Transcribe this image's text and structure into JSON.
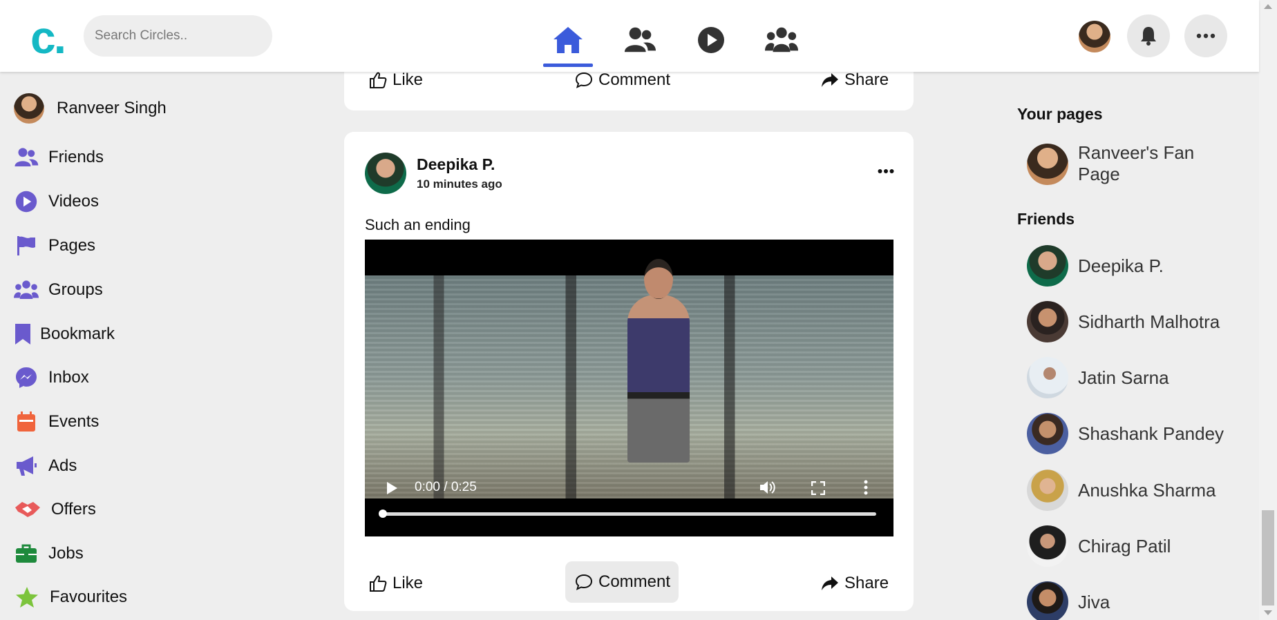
{
  "header": {
    "logo_text": "c.",
    "search_placeholder": "Search Circles..",
    "nav": [
      {
        "name": "home",
        "active": true
      },
      {
        "name": "friends",
        "active": false
      },
      {
        "name": "watch",
        "active": false
      },
      {
        "name": "groups",
        "active": false
      }
    ],
    "accent_color": "#3b5bdb",
    "logo_color": "#14b8c4"
  },
  "left_sidebar": {
    "profile_name": "Ranveer Singh",
    "items": [
      {
        "label": "Friends",
        "icon": "friends-icon",
        "color": "#6a5acd"
      },
      {
        "label": "Videos",
        "icon": "play-circle-icon",
        "color": "#6a5acd"
      },
      {
        "label": "Pages",
        "icon": "flag-icon",
        "color": "#6a5acd"
      },
      {
        "label": "Groups",
        "icon": "groups-icon",
        "color": "#6a5acd"
      },
      {
        "label": "Bookmark",
        "icon": "bookmark-icon",
        "color": "#6a5acd"
      },
      {
        "label": "Inbox",
        "icon": "messenger-icon",
        "color": "#6a5acd"
      },
      {
        "label": "Events",
        "icon": "calendar-icon",
        "color": "#f0643c"
      },
      {
        "label": "Ads",
        "icon": "megaphone-icon",
        "color": "#6a5acd"
      },
      {
        "label": "Offers",
        "icon": "handshake-icon",
        "color": "#e85a5a"
      },
      {
        "label": "Jobs",
        "icon": "briefcase-icon",
        "color": "#1e8a3c"
      },
      {
        "label": "Favourites",
        "icon": "star-icon",
        "color": "#7cc43c"
      }
    ]
  },
  "feed": {
    "previous_post_actions": {
      "like": "Like",
      "comment": "Comment",
      "share": "Share"
    },
    "post": {
      "author": "Deepika P.",
      "time": "10 minutes ago",
      "text": "Such an ending",
      "video": {
        "time_display": "0:00 / 0:25",
        "progress": 0
      },
      "actions": {
        "like": "Like",
        "comment": "Comment",
        "share": "Share"
      }
    }
  },
  "right_sidebar": {
    "pages_heading": "Your pages",
    "pages": [
      {
        "name": "Ranveer's Fan Page"
      }
    ],
    "friends_heading": "Friends",
    "friends": [
      {
        "name": "Deepika P."
      },
      {
        "name": "Sidharth Malhotra"
      },
      {
        "name": "Jatin Sarna"
      },
      {
        "name": "Shashank Pandey"
      },
      {
        "name": "Anushka Sharma"
      },
      {
        "name": "Chirag Patil"
      },
      {
        "name": "Jiva"
      }
    ]
  }
}
